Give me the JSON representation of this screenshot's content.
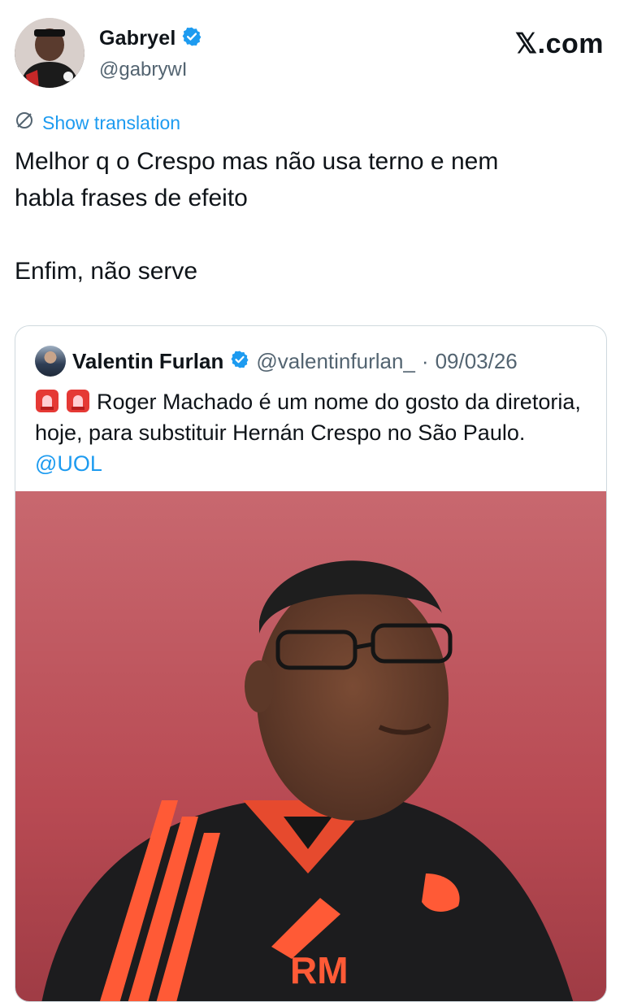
{
  "author": {
    "name": "Gabryel",
    "handle": "@gabrywI",
    "verified": true
  },
  "brand": "𝕏.com",
  "translation": {
    "label": "Show translation",
    "icon": "globe-slash-icon"
  },
  "tweet": {
    "text": "Melhor q o Crespo mas não usa terno e nem\nhabla frases de efeito\n\nEnfim, não serve"
  },
  "quote": {
    "name": "Valentin Furlan",
    "handle": "@valentinfurlan_",
    "separator": "·",
    "date": "09/03/26",
    "verified": true,
    "text": "Roger Machado é um nome do gosto da diretoria, hoje, para substituir Hernán Crespo no São Paulo.",
    "mention": "@UOL",
    "image_monogram": "RM"
  },
  "colors": {
    "accent": "#1d9bf0",
    "text": "#0f1419",
    "muted": "#536471",
    "border": "#cfd9de"
  }
}
